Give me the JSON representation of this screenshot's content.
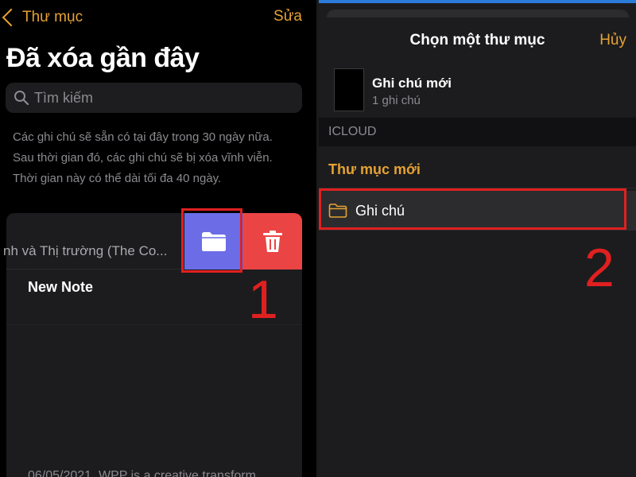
{
  "left_panel": {
    "back_label": "Thư mục",
    "edit_label": "Sửa",
    "title": "Đã xóa gần đây",
    "search_placeholder": "Tìm kiếm",
    "info_text": "Các ghi chú sẽ sẵn có tại đây trong 30 ngày nữa. Sau thời gian đó, các ghi chú sẽ bị xóa vĩnh viễn. Thời gian này có thể dài tối đa 40 ngày.",
    "swiped_row_title": "nh và Thị trường (The Co...",
    "note_title": "New Note",
    "note_preview": "06/05/2021. WPP is a creative transform",
    "actions": {
      "move_icon": "folder-icon",
      "delete_icon": "trash-icon",
      "move_color": "#6b6ce6",
      "delete_color": "#eb4444"
    },
    "step_number": "1"
  },
  "right_panel": {
    "sheet_title": "Chọn một thư mục",
    "cancel_label": "Hủy",
    "current_note": {
      "name": "Ghi chú mới",
      "count": "1 ghi chú"
    },
    "section_label": "ICLOUD",
    "new_folder_label": "Thư mục mới",
    "folder": {
      "name": "Ghi chú",
      "icon": "folder-icon"
    },
    "step_number": "2"
  },
  "colors": {
    "accent": "#e6a233",
    "highlight": "#e02020",
    "background": "#000000"
  }
}
